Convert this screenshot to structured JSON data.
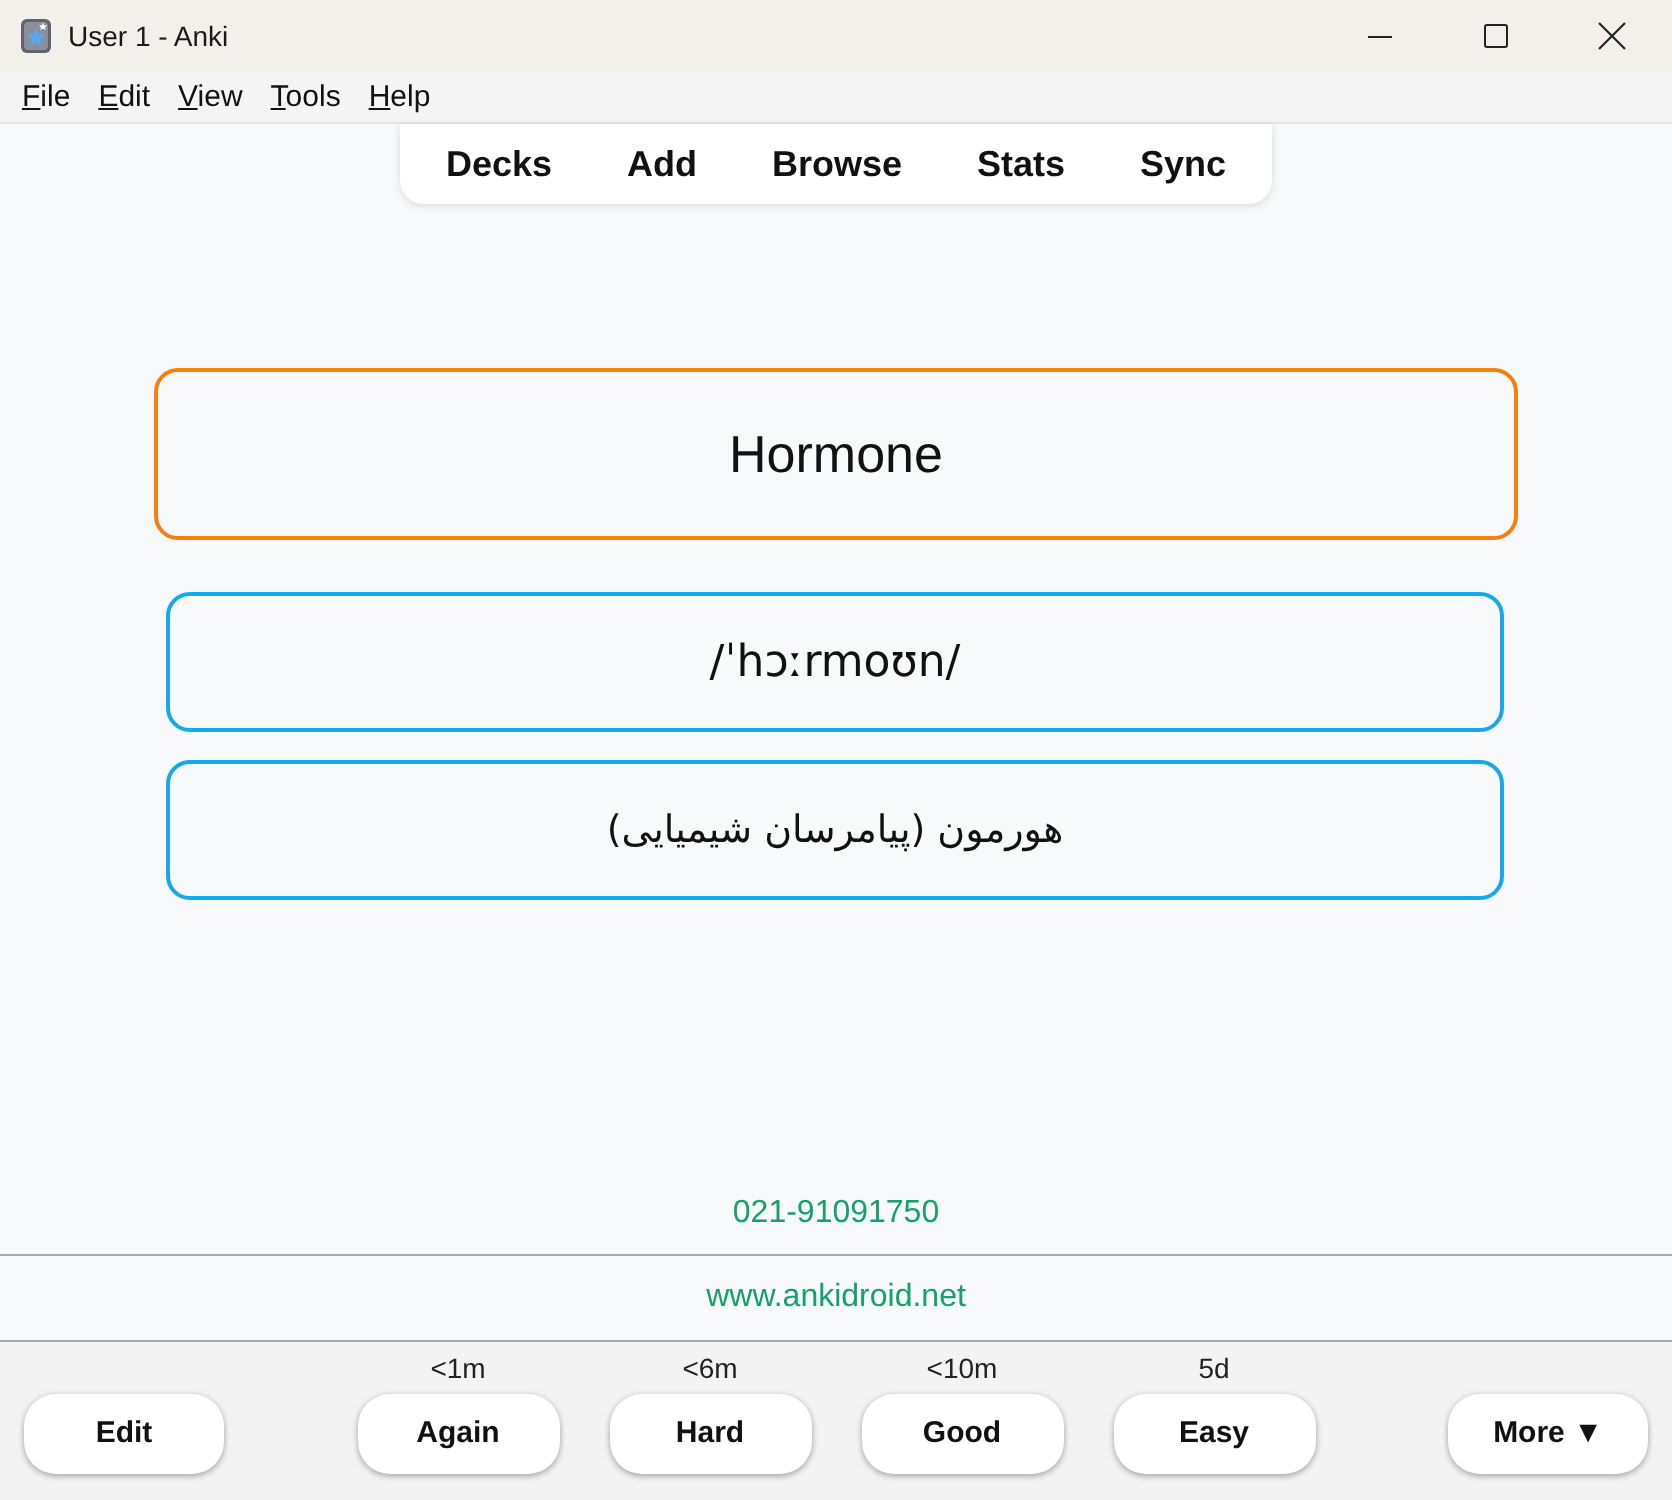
{
  "window": {
    "title": "User 1 - Anki"
  },
  "menu": [
    "File",
    "Edit",
    "View",
    "Tools",
    "Help"
  ],
  "toolbar": [
    "Decks",
    "Add",
    "Browse",
    "Stats",
    "Sync"
  ],
  "card": {
    "front": "Hormone",
    "fields": [
      {
        "kind": "pronunciation",
        "text": "/ˈhɔːrmoʊn/"
      },
      {
        "kind": "translation",
        "text": "هورمون (پیامرسان شیمیایی)"
      }
    ],
    "contact_number": "021-91091750",
    "website": "www.ankidroid.net"
  },
  "answer_bar": {
    "edit_button": "Edit",
    "ease_buttons": [
      {
        "due": "<1m",
        "label": "Again"
      },
      {
        "due": "<6m",
        "label": "Hard"
      },
      {
        "due": "<10m",
        "label": "Good"
      },
      {
        "due": "5d",
        "label": "Easy"
      }
    ],
    "more_button": "More ▼"
  }
}
